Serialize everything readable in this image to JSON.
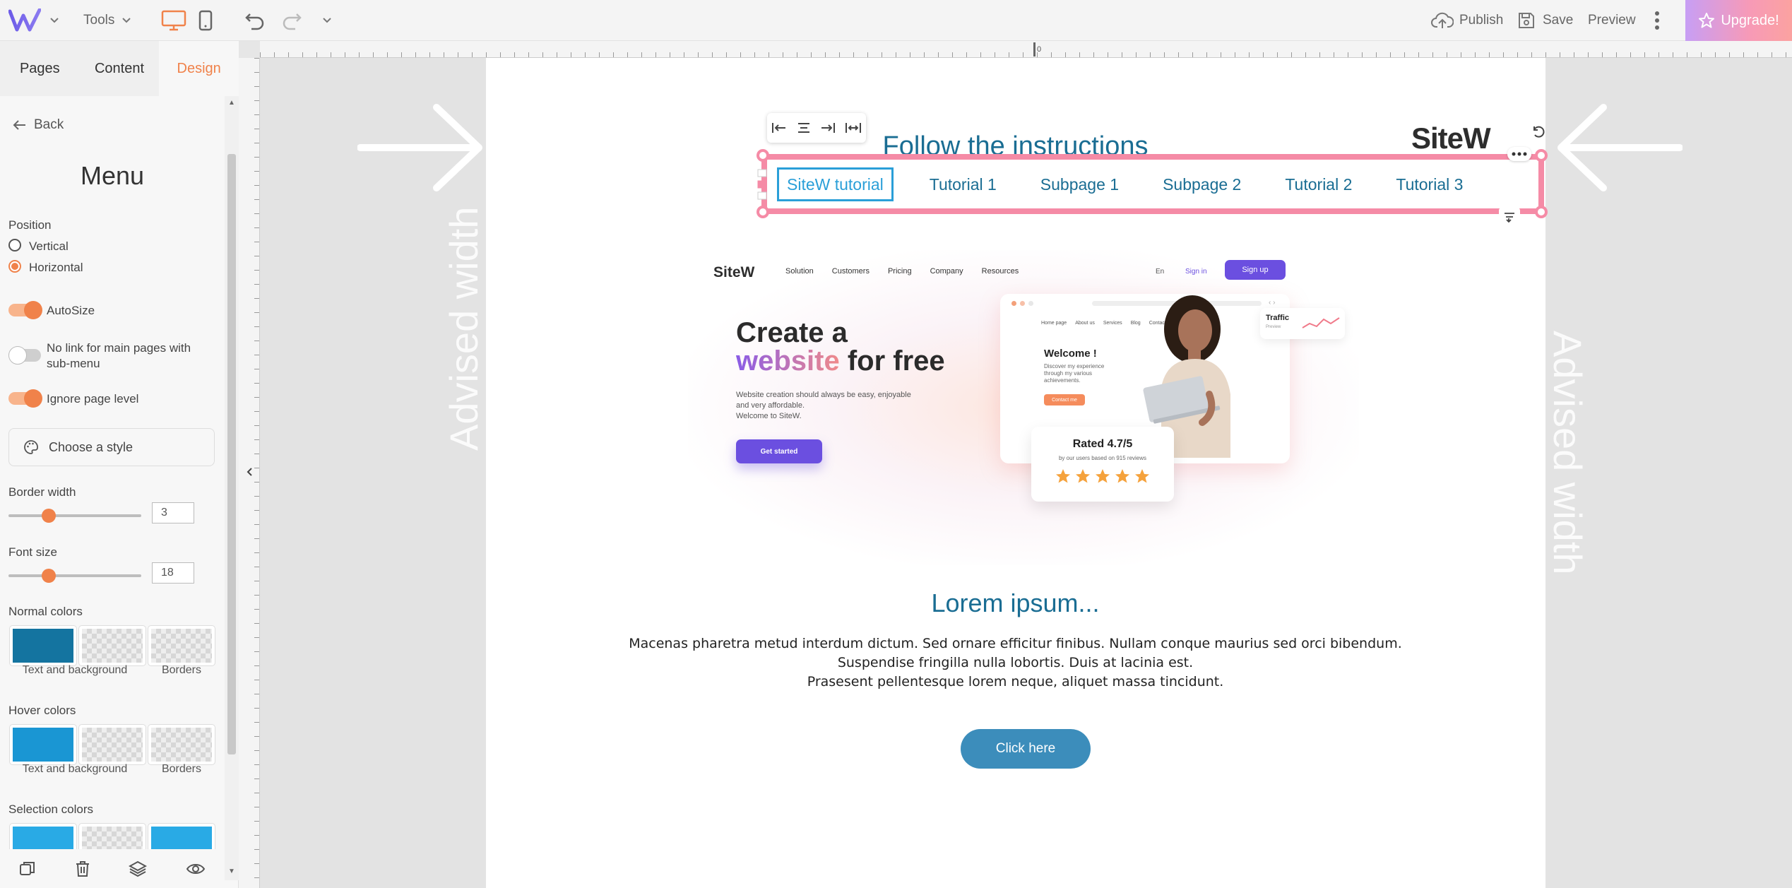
{
  "topbar": {
    "tools_label": "Tools",
    "publish_label": "Publish",
    "save_label": "Save",
    "preview_label": "Preview",
    "upgrade_label": "Upgrade!"
  },
  "panel": {
    "tabs": [
      {
        "label": "Pages"
      },
      {
        "label": "Content"
      },
      {
        "label": "Design"
      }
    ],
    "back_label": "Back",
    "title": "Menu",
    "position_label": "Position",
    "position_options": [
      "Vertical",
      "Horizontal"
    ],
    "autosize_label": "AutoSize",
    "nolink_label": "No link for main pages with sub-menu",
    "ignore_level_label": "Ignore page level",
    "choose_style_label": "Choose a style",
    "border_width_label": "Border width",
    "border_width_value": "3",
    "font_size_label": "Font size",
    "font_size_value": "18",
    "normal_colors_label": "Normal colors",
    "hover_colors_label": "Hover colors",
    "selection_colors_label": "Selection colors",
    "text_bg_label": "Text and background",
    "borders_label": "Borders"
  },
  "colors": {
    "accent": "#f0824a",
    "normal_text": "#1474a0",
    "hover_text": "#1a96d3",
    "selection_text": "#29aae5",
    "menu_text": "#1a6d93",
    "selection_border": "#f58ba6"
  },
  "canvas": {
    "advised_width_label": "Advised width",
    "ruler_zero": "0",
    "page_title": "Follow the instructions",
    "logo_text": "SiteW",
    "menu_items": [
      "SiteW tutorial",
      "Tutorial 1",
      "Subpage 1",
      "Subpage 2",
      "Tutorial 2",
      "Tutorial 3"
    ],
    "hero": {
      "logo": "SiteW",
      "nav": [
        "Solution",
        "Customers",
        "Pricing",
        "Company",
        "Resources"
      ],
      "lang": "En",
      "signin": "Sign in",
      "signup": "Sign up",
      "headline_1": "Create a",
      "headline_2a": "website",
      "headline_2b": " for free",
      "subtext_1": "Website creation should always be easy, enjoyable",
      "subtext_2": "and very affordable.",
      "subtext_3": "Welcome to SiteW.",
      "cta": "Get started",
      "mock_nav": [
        "Home page",
        "About us",
        "Services",
        "Blog",
        "Contact"
      ],
      "mock_welcome": "Welcome !",
      "mock_text_1": "Discover my experience",
      "mock_text_2": "through my various",
      "mock_text_3": "achievements.",
      "mock_button": "Contact me",
      "traffic_label": "Traffic",
      "traffic_sub": "Preview",
      "rating_title": "Rated 4.7/5",
      "rating_sub": "by our users based on 915 reviews",
      "stars": 5
    },
    "lorem_title": "Lorem ipsum...",
    "lorem_lines": [
      "Macenas pharetra metud interdum dictum. Sed ornare efficitur finibus. Nullam conque maurius sed orci bibendum.",
      "Suspendise fringilla nulla lobortis. Duis at lacinia est.",
      "Prasesent pellentesque lorem neque, aliquet massa tincidunt."
    ],
    "cta_label": "Click here"
  }
}
